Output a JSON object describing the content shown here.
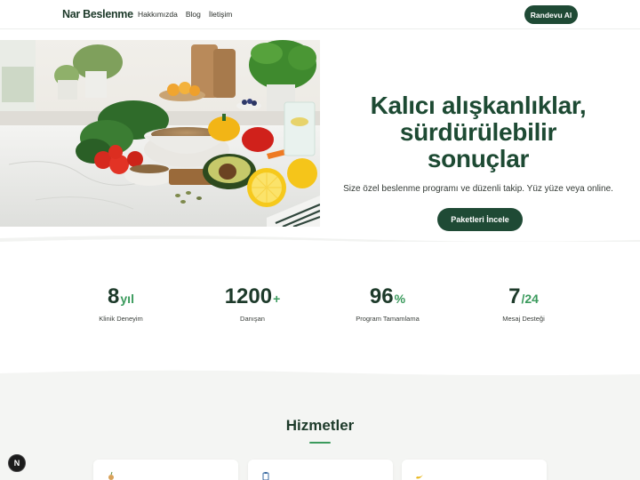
{
  "header": {
    "logo": "Nar Beslenme",
    "nav": [
      "Hakkımızda",
      "Blog",
      "İletişim"
    ],
    "cta": "Randevu Al"
  },
  "hero": {
    "title_lines": [
      "Kalıcı alışkanlıklar,",
      "sürdürülebilir",
      "sonuçlar"
    ],
    "subtitle": "Size özel beslenme programı ve düzenli takip. Yüz yüze veya online.",
    "cta": "Paketleri İncele"
  },
  "stats": [
    {
      "value": "8",
      "suffix": "yıl",
      "label": "Klinik Deneyim"
    },
    {
      "value": "1200",
      "suffix": "+",
      "label": "Danışan"
    },
    {
      "value": "96",
      "suffix": "%",
      "label": "Program Tamamlama"
    },
    {
      "value": "7",
      "suffix": "/24",
      "label": "Mesaj Desteği"
    }
  ],
  "services": {
    "title": "Hizmetler",
    "cards": [
      {
        "icon": "apple-icon"
      },
      {
        "icon": "clipboard-icon"
      },
      {
        "icon": "banana-icon"
      }
    ]
  },
  "badge": {
    "letter": "N"
  },
  "colors": {
    "brand": "#1f4a35",
    "accent": "#3a9a5c",
    "section_bg": "#f4f5f3"
  }
}
